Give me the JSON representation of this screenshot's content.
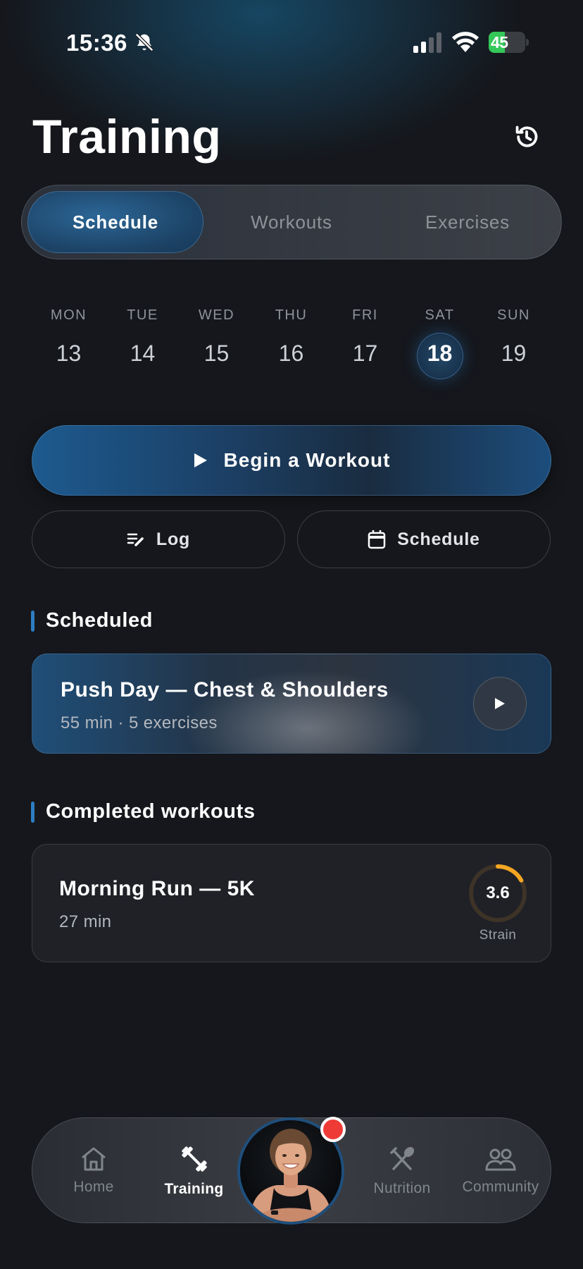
{
  "status_bar": {
    "time": "15:36",
    "battery": "45",
    "battery_level": 0.45,
    "icons": [
      "bell-slash-icon",
      "cellular-signal-icon",
      "wifi-icon",
      "battery-charging-icon"
    ]
  },
  "header": {
    "title": "Training",
    "history_icon": "history-icon"
  },
  "tabs": [
    {
      "label": "Schedule",
      "active": true
    },
    {
      "label": "Workouts",
      "active": false
    },
    {
      "label": "Exercises",
      "active": false
    }
  ],
  "week": [
    {
      "day": "MON",
      "date": "13"
    },
    {
      "day": "TUE",
      "date": "14"
    },
    {
      "day": "WED",
      "date": "15"
    },
    {
      "day": "THU",
      "date": "16"
    },
    {
      "day": "FRI",
      "date": "17"
    },
    {
      "day": "SAT",
      "date": "18",
      "selected": true
    },
    {
      "day": "SUN",
      "date": "19"
    }
  ],
  "actions": {
    "begin_label": "Begin a Workout",
    "log_label": "Log",
    "schedule_label": "Schedule"
  },
  "scheduled": {
    "title": "Scheduled",
    "card": {
      "name": "Push Day — Chest & Shoulders",
      "meta": "55 min · 5 exercises"
    }
  },
  "completed": {
    "title": "Completed workouts",
    "card": {
      "name": "Morning Run — 5K",
      "meta": "27 min",
      "strain_value": "3.6",
      "strain_label": "Strain",
      "strain_fraction": 0.17
    }
  },
  "nav": {
    "items": [
      {
        "label": "Home",
        "icon": "home-icon"
      },
      {
        "label": "Training",
        "icon": "dumbbell-icon",
        "active": true
      },
      {
        "label": "Nutrition",
        "icon": "utensils-icon"
      },
      {
        "label": "Community",
        "icon": "community-icon"
      }
    ],
    "avatar_icon": "avatar"
  },
  "colors": {
    "background": "#15171c",
    "accent_blue": "#1f5a8f",
    "strain_orange": "#f5a623",
    "battery_green": "#34c759",
    "notification_red": "#ef3b36"
  }
}
